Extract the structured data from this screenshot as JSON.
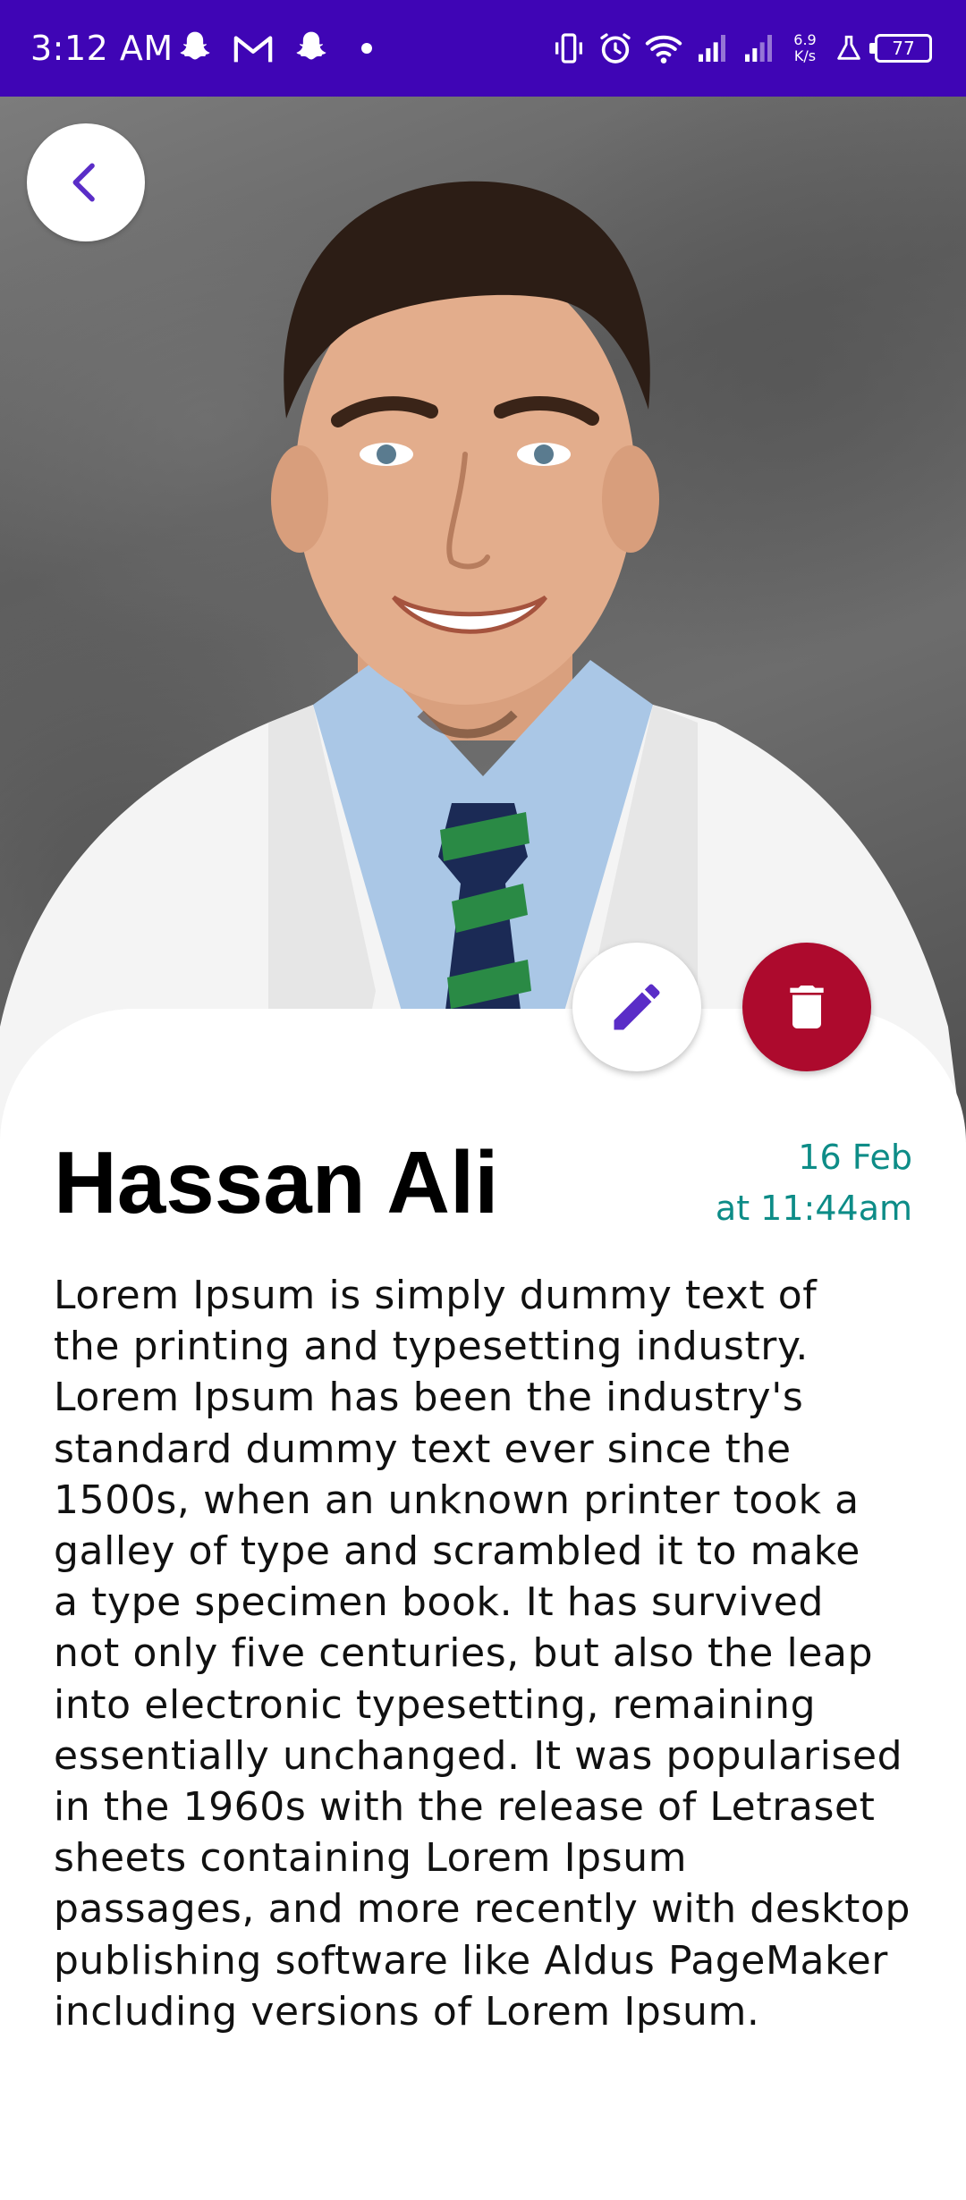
{
  "status_bar": {
    "time": "3:12 AM",
    "net_speed_value": "6.9",
    "net_speed_unit": "K/s",
    "battery_level": "77",
    "left_icons": [
      "snapchat-icon",
      "gmail-icon",
      "snapchat-icon",
      "dot-icon"
    ],
    "right_icons": [
      "vibrate-icon",
      "alarm-icon",
      "wifi-icon",
      "signal-icon",
      "signal-icon",
      "lab-icon",
      "battery-icon"
    ],
    "background_color": "#3f05b5"
  },
  "header": {
    "back_icon": "chevron-left-icon"
  },
  "actions": {
    "edit_icon": "pencil-icon",
    "delete_icon": "trash-icon",
    "delete_color": "#ad0a2d",
    "accent_color": "#5a2dc7"
  },
  "profile": {
    "name": "Hassan Ali",
    "date_line1": "16 Feb",
    "date_line2": "at 11:44am",
    "date_color": "#0d8c87",
    "description_lines": [
      "Lorem Ipsum is simply dummy text of",
      "the printing and typesetting industry.",
      "Lorem Ipsum has been the industry's",
      "standard dummy text ever since the",
      "1500s, when an unknown printer took a",
      "galley of type and scrambled it to make",
      "a type specimen book. It has survived",
      "not only five centuries, but also the leap",
      "into electronic typesetting, remaining",
      "essentially unchanged. It was popularised",
      "in the 1960s with the release of Letraset",
      "sheets containing Lorem Ipsum",
      "passages, and more recently with desktop",
      "publishing software like Aldus PageMaker",
      "including versions of Lorem Ipsum."
    ]
  }
}
